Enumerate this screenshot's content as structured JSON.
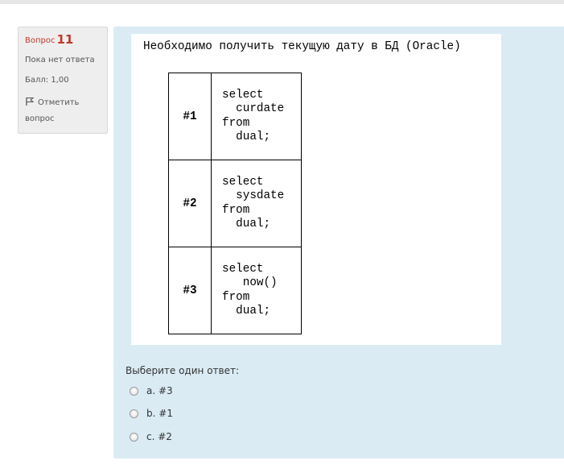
{
  "info": {
    "question_label": "Вопрос",
    "question_number": "11",
    "state": "Пока нет ответа",
    "grade": "Балл: 1,00",
    "flag_label": "Отметить",
    "flag_label2": "вопрос"
  },
  "question": {
    "text": "Необходимо получить текущую дату в БД (Oracle)",
    "options_table": [
      {
        "label": "#1",
        "code": "select\n  curdate\nfrom\n  dual;"
      },
      {
        "label": "#2",
        "code": "select\n  sysdate\nfrom\n  dual;"
      },
      {
        "label": "#3",
        "code": "select\n   now()\nfrom\n  dual;"
      }
    ]
  },
  "answer_prompt": "Выберите один ответ:",
  "answers": [
    {
      "letter": "a.",
      "text": "#3"
    },
    {
      "letter": "b.",
      "text": "#1"
    },
    {
      "letter": "c.",
      "text": "#2"
    }
  ],
  "colors": {
    "question_number": "#c0392b",
    "content_bg": "#daebf4",
    "info_bg": "#eeeeee"
  }
}
